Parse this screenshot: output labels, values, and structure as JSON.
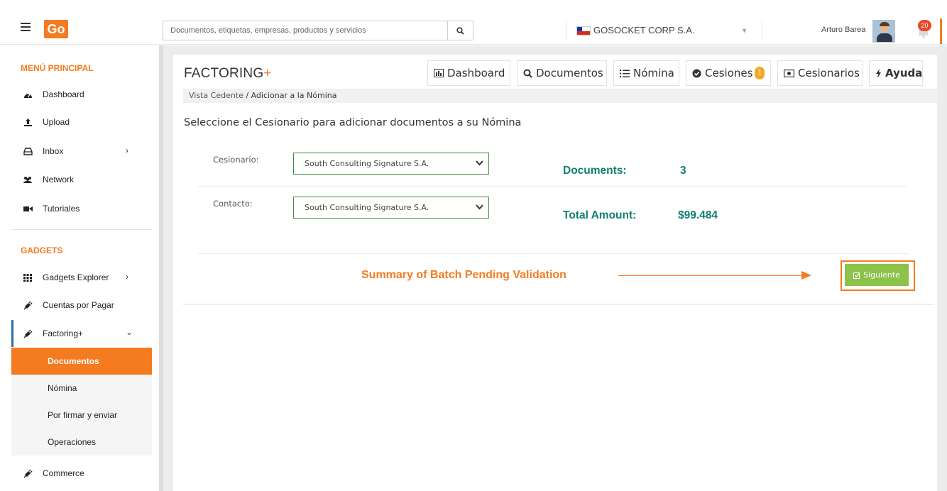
{
  "header": {
    "logo_text": "Go",
    "search_placeholder": "Documentos, etiquetas, empresas, productos y servicios",
    "company": "GOSOCKET CORP S.A.",
    "user_name": "Arturo Barea",
    "notifications": "20"
  },
  "sidebar": {
    "main_title": "MENÚ PRINCIPAL",
    "main_items": [
      {
        "label": "Dashboard",
        "icon": "dashboard-icon"
      },
      {
        "label": "Upload",
        "icon": "upload-icon"
      },
      {
        "label": "Inbox",
        "icon": "inbox-icon"
      },
      {
        "label": "Network",
        "icon": "network-icon"
      },
      {
        "label": "Tutoriales",
        "icon": "video-icon"
      }
    ],
    "gadgets_title": "GADGETS",
    "gadget_items": [
      {
        "label": "Gadgets Explorer",
        "icon": "grid-icon"
      },
      {
        "label": "Cuentas por Pagar",
        "icon": "plug-icon"
      },
      {
        "label": "Factoring+",
        "icon": "plug-icon"
      }
    ],
    "factoring_sub": [
      {
        "label": "Documentos",
        "active": true
      },
      {
        "label": "Nómina"
      },
      {
        "label": "Por firmar y enviar"
      },
      {
        "label": "Operaciones"
      }
    ],
    "commerce": "Commerce"
  },
  "main": {
    "app_title": "FACTORING",
    "app_title_plus": "+",
    "nav": [
      {
        "label": "Dashboard",
        "icon": "bar-chart-icon"
      },
      {
        "label": "Documentos",
        "icon": "search-icon"
      },
      {
        "label": "Nómina",
        "icon": "list-icon"
      },
      {
        "label": "Cesiones",
        "icon": "check-circle-icon",
        "badge": "1"
      },
      {
        "label": "Cesionarios",
        "icon": "money-icon"
      },
      {
        "label": "Ayuda",
        "icon": "bolt-icon"
      }
    ],
    "breadcrumb_parent": "Vista Cedente",
    "breadcrumb_sep": " / ",
    "breadcrumb_current": "Adicionar a la Nómina",
    "heading": "Seleccione el Cesionario para adicionar documentos a su Nómina",
    "cesionario_label": "Cesionario:",
    "cesionario_value": "South Consulting Signature S.A.",
    "contacto_label": "Contacto:",
    "contacto_value": "South Consulting Signature S.A.",
    "documents_label": "Documents:",
    "documents_value": "3",
    "total_label": "Total Amount:",
    "total_value": "$99.484",
    "annotation": "Summary of Batch Pending Validation",
    "next_button": "Siguiente"
  },
  "colors": {
    "accent": "#f47b20",
    "teal": "#0f7f6f",
    "green_button": "#8bc34a",
    "select_border": "#3c8a3f"
  }
}
